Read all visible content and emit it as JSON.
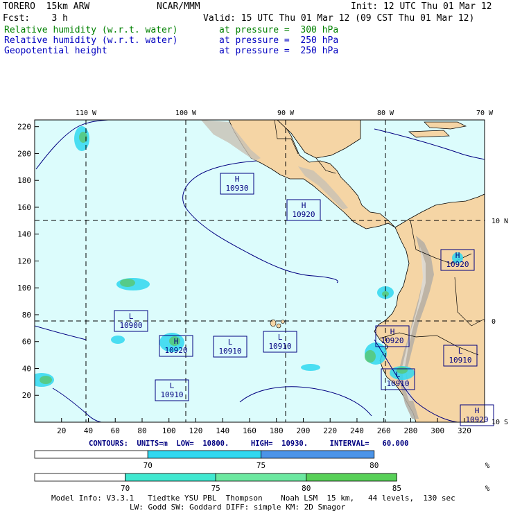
{
  "header": {
    "model": "TORERO  15km ARW",
    "org": "NCAR/MMM",
    "init": "Init: 12 UTC Thu 01 Mar 12",
    "fcst": "Fcst:    3 h",
    "valid": "Valid: 15 UTC Thu 01 Mar 12 (09 CST Thu 01 Mar 12)",
    "fields": [
      {
        "name": "Relative humidity (w.r.t. water)",
        "level": "at pressure =  300 hPa",
        "color": "#008000"
      },
      {
        "name": "Relative humidity (w.r.t. water)",
        "level": "at pressure =  250 hPa",
        "color": "#0000c0"
      },
      {
        "name": "Geopotential height",
        "level": "at pressure =  250 hPa",
        "color": "#0000c0"
      }
    ]
  },
  "map": {
    "lon_labels": [
      "110 W",
      "100 W",
      "90 W",
      "80 W",
      "70 W"
    ],
    "lat_labels": [
      "10 N",
      "0",
      "10 S"
    ],
    "x_ticks": [
      "20",
      "40",
      "60",
      "80",
      "100",
      "120",
      "140",
      "160",
      "180",
      "200",
      "220",
      "240",
      "260",
      "280",
      "300",
      "320"
    ],
    "y_ticks": [
      "20",
      "40",
      "60",
      "80",
      "100",
      "120",
      "140",
      "160",
      "180",
      "200",
      "220"
    ],
    "ocean_color": "#dcfcfc",
    "land_color": "#f5d5a5",
    "contour_color": "#000080",
    "hl_labels": [
      {
        "type": "H",
        "value": "10930"
      },
      {
        "type": "H",
        "value": "10920"
      },
      {
        "type": "H",
        "value": "10920"
      },
      {
        "type": "L",
        "value": "10900"
      },
      {
        "type": "H",
        "value": "10920"
      },
      {
        "type": "L",
        "value": "10910"
      },
      {
        "type": "L",
        "value": "10910"
      },
      {
        "type": "H",
        "value": "10920"
      },
      {
        "type": "L",
        "value": "10910"
      },
      {
        "type": "L",
        "value": "10910"
      },
      {
        "type": "L",
        "value": "10910"
      },
      {
        "type": "H",
        "value": "10920"
      }
    ]
  },
  "contour_info": "CONTOURS:  UNITS=m  LOW=  10800.     HIGH=  10930.     INTERVAL=   60.000",
  "colorbar1": {
    "labels": [
      "70",
      "75",
      "80"
    ],
    "unit": "%",
    "colors": [
      "#ffffff",
      "#30d8f0",
      "#4c94e8"
    ]
  },
  "colorbar2": {
    "labels": [
      "70",
      "75",
      "80",
      "85"
    ],
    "unit": "%",
    "colors": [
      "#ffffff",
      "#40e8d0",
      "#6ce8a0",
      "#58d058"
    ]
  },
  "footer": {
    "line1": "Model Info: V3.3.1   Tiedtke YSU PBL  Thompson    Noah LSM  15 km,   44 levels,  130 sec",
    "line2": "LW: Godd SW: Goddard DIFF: simple KM: 2D Smagor"
  }
}
